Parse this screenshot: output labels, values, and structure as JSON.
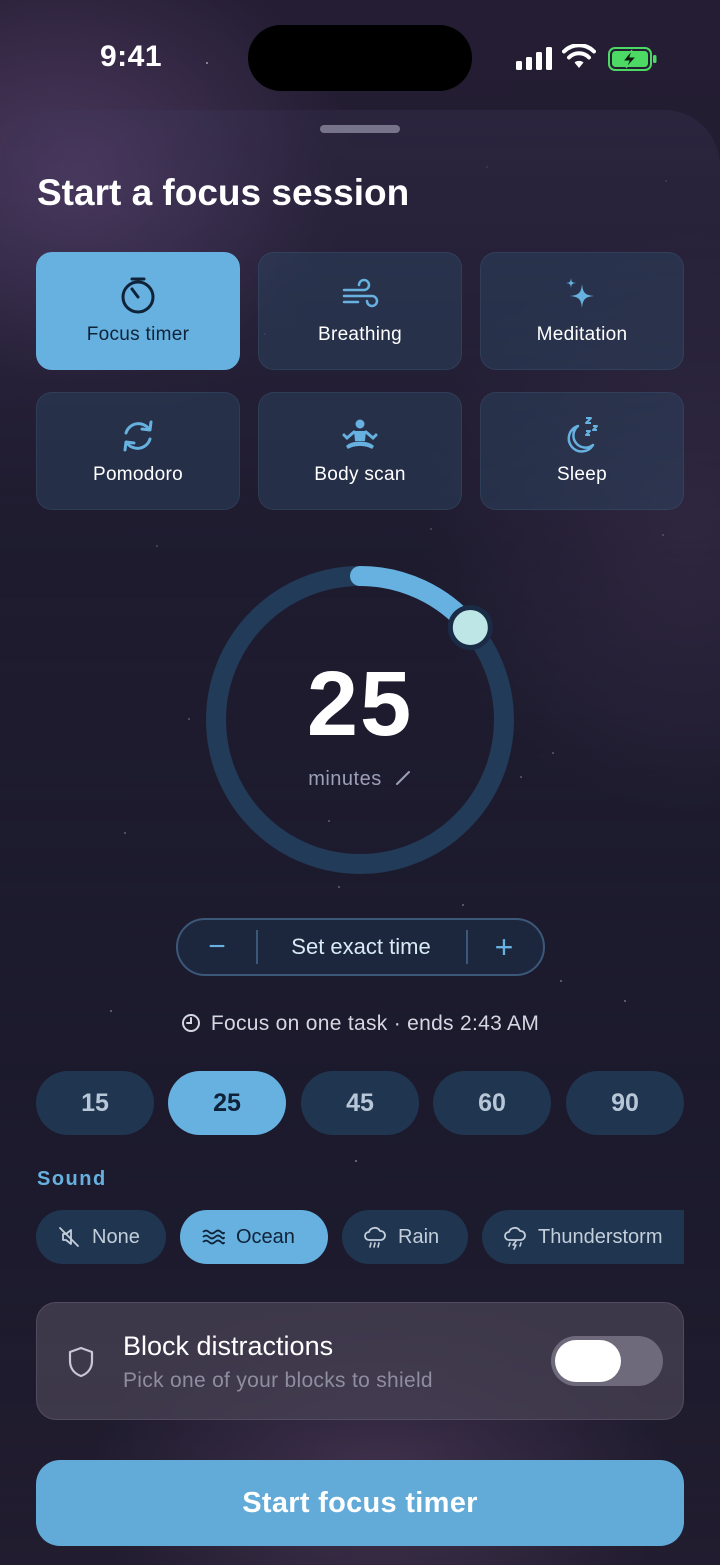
{
  "status_bar": {
    "time": "9:41"
  },
  "sheet": {
    "title": "Start a focus session"
  },
  "modes": [
    {
      "label": "Focus timer",
      "icon": "stopwatch-icon",
      "selected": true
    },
    {
      "label": "Breathing",
      "icon": "wind-icon",
      "selected": false
    },
    {
      "label": "Meditation",
      "icon": "sparkles-icon",
      "selected": false
    },
    {
      "label": "Pomodoro",
      "icon": "refresh-cycle-icon",
      "selected": false
    },
    {
      "label": "Body scan",
      "icon": "meditating-figure-icon",
      "selected": false
    },
    {
      "label": "Sleep",
      "icon": "moon-zzz-icon",
      "selected": false
    }
  ],
  "dial": {
    "value": "25",
    "unit": "minutes",
    "progress_fraction": 0.1389
  },
  "stepper": {
    "minus": "−",
    "label": "Set exact time",
    "plus": "+"
  },
  "end_info": "Focus on one task · ends 2:43 AM",
  "presets": [
    {
      "label": "15",
      "selected": false
    },
    {
      "label": "25",
      "selected": true
    },
    {
      "label": "45",
      "selected": false
    },
    {
      "label": "60",
      "selected": false
    },
    {
      "label": "90",
      "selected": false
    }
  ],
  "sound": {
    "label": "Sound",
    "options": [
      {
        "label": "None",
        "icon": "speaker-muted-icon",
        "selected": false
      },
      {
        "label": "Ocean",
        "icon": "waves-icon",
        "selected": true
      },
      {
        "label": "Rain",
        "icon": "rain-cloud-icon",
        "selected": false
      },
      {
        "label": "Thunderstorm",
        "icon": "thunderstorm-cloud-icon",
        "selected": false
      }
    ]
  },
  "block_distractions": {
    "title": "Block distractions",
    "subtitle": "Pick one of your blocks to shield",
    "enabled": false
  },
  "cta": {
    "label": "Start focus timer"
  },
  "colors": {
    "accent": "#66b1e0",
    "chip_bg": "#203550",
    "card_bg": "#2d4664",
    "cta": "#62aad8"
  }
}
